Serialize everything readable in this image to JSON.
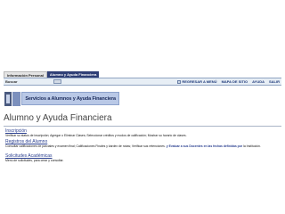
{
  "tabs": [
    {
      "label": "Información Personal",
      "active": false
    },
    {
      "label": "Alumno y Ayuda Financiera",
      "active": true
    }
  ],
  "navbar": {
    "search_label": "Buscar",
    "links": [
      "REGRESAR A MENÚ",
      "MAPA DE SITIO",
      "AYUDA",
      "SALIR"
    ]
  },
  "banner": {
    "text": "Servicios a Alumnos y Ayuda Financiera"
  },
  "page_title": "Alumno y Ayuda Financiera",
  "sections": [
    {
      "link": "Inscripción",
      "description": "Verificar su status de inscripción; Agregar o Eliminar Clases; Seleccionar créditos y modos de calificación; Mostrar su horario de clases."
    },
    {
      "link": "Registros del Alumno",
      "description_before": "Consultar calificaciones de parciales y examen final; Calificaciones Finales y kárdex de notas; Verificar sus retenciones.",
      "description_highlight": "y Evaluar a sus Docentes en las fechas definidas por",
      "description_after": "la Institución."
    },
    {
      "link": "Solicitudes Académicas",
      "description": "Menú de solicitudes, para crear y consultar."
    }
  ],
  "colors": {
    "tab_active_bg": "#2f3f76",
    "navbar_bg": "#e7eef5",
    "link": "#2a3f8f",
    "banner_bg": "#b9c8e6"
  },
  "icons": [
    "search-icon",
    "menu-icon",
    "sitemap-icon",
    "help-icon",
    "exit-icon",
    "logo-icon"
  ]
}
